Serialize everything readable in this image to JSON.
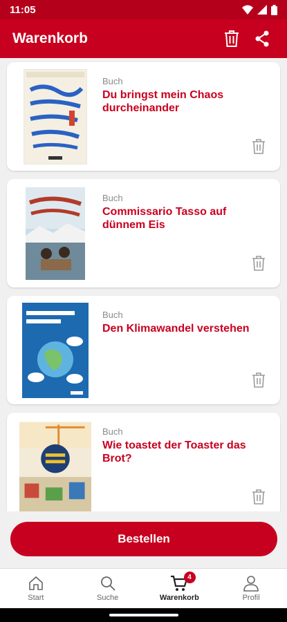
{
  "status": {
    "time": "11:05"
  },
  "header": {
    "title": "Warenkorb"
  },
  "items": [
    {
      "type": "Buch",
      "title": "Du bringst mein Chaos durcheinander"
    },
    {
      "type": "Buch",
      "title": "Commissario Tasso auf dünnem Eis"
    },
    {
      "type": "Buch",
      "title": "Den Klimawandel verstehen"
    },
    {
      "type": "Buch",
      "title": "Wie toastet der Toaster das Brot?"
    }
  ],
  "order_button": {
    "label": "Bestellen"
  },
  "nav": {
    "items": [
      {
        "label": "Start",
        "icon": "home-icon"
      },
      {
        "label": "Suche",
        "icon": "search-icon"
      },
      {
        "label": "Warenkorb",
        "icon": "cart-icon",
        "badge": "4"
      },
      {
        "label": "Profil",
        "icon": "profile-icon"
      }
    ]
  },
  "colors": {
    "brand": "#c8001f",
    "statusbar": "#b5001c"
  }
}
